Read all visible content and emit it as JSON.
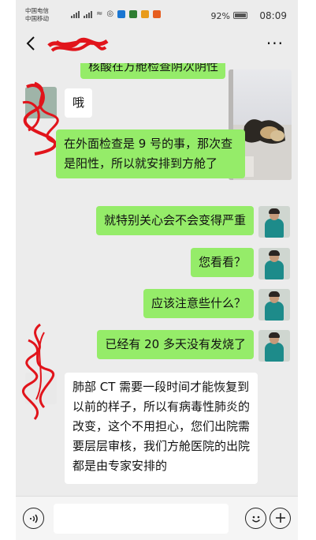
{
  "status_bar": {
    "carrier_line1": "中国电信",
    "carrier_line2": "中国移动",
    "battery_percent": "92%",
    "time": "08:09"
  },
  "header": {
    "back_icon": "chevron-left-icon",
    "more_label": "···"
  },
  "messages": [
    {
      "side": "right",
      "type": "text",
      "text": "核酸在方舱检查阴次阴性"
    },
    {
      "side": "right",
      "type": "image",
      "icon": "photo-thumbnail"
    },
    {
      "side": "left",
      "type": "text",
      "text": "哦"
    },
    {
      "side": "left",
      "type": "text",
      "text": "在外面检查是 9 号的事，那次查是阳性，所以就安排到方舱了"
    },
    {
      "side": "right",
      "type": "text",
      "text": "就特别关心会不会变得严重"
    },
    {
      "side": "right",
      "type": "text",
      "text": "您看看？"
    },
    {
      "side": "right",
      "type": "text",
      "text": "应该注意些什么？"
    },
    {
      "side": "right",
      "type": "text",
      "text": "已经有 20 多天没有发烧了"
    },
    {
      "side": "left",
      "type": "text",
      "text": "肺部 CT 需要一段时间才能恢复到以前的样子，所以有病毒性肺炎的改变，这个不用担心，您们出院需要层层审核，我们方舱医院的出院都是由专家安排的"
    }
  ],
  "input_bar": {
    "voice_icon": "voice-icon",
    "emoji_icon": "emoji-icon",
    "plus_icon": "plus-icon"
  },
  "colors": {
    "my_bubble": "#95ec69",
    "their_bubble": "#ffffff",
    "background": "#ececec",
    "redaction": "#e1141b"
  }
}
